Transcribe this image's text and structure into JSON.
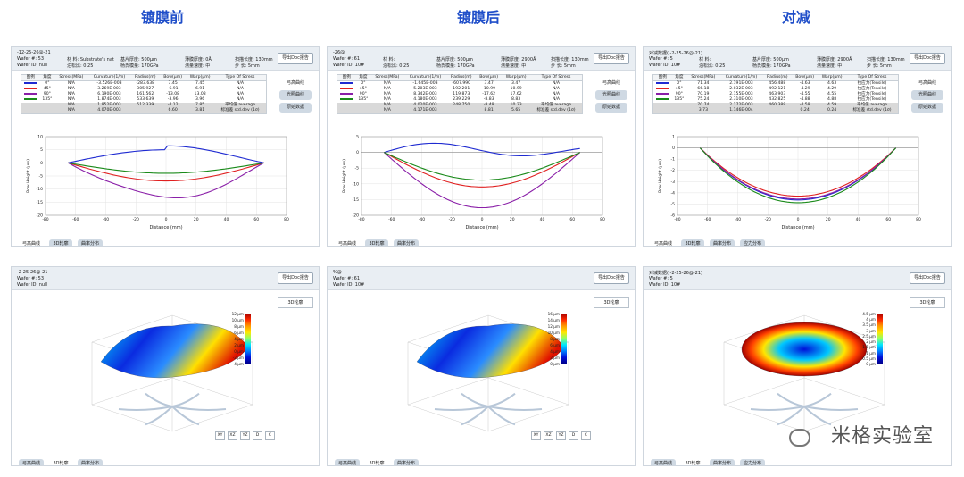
{
  "titles": [
    "镀膜前",
    "镀膜后",
    "对减"
  ],
  "panels_top": [
    {
      "title": "-12-25-26@-21",
      "wafer": "Wafer #: 53",
      "wafer_id": "Wafer ID: null",
      "mat": "材 料: Substrate's nat",
      "poisson": "泊松比: 0.25",
      "thk": "基片厚度: 500μm",
      "mod": "杨氏模量: 170GPa",
      "film": "薄膜厚度: 0Å",
      "spd": "测量速度: 中",
      "len": "扫描长度: 130mm",
      "step": "步 长: 5mm",
      "rows": [
        {
          "c": "#1f2bd1",
          "a": "0°",
          "s": "N/A",
          "cu": "-3.526E-003",
          "r": "-283.638",
          "b": "7.45",
          "w": "7.45",
          "t": "N/A"
        },
        {
          "c": "#e02020",
          "a": "45°",
          "s": "N/A",
          "cu": "3.269E-003",
          "r": "305.927",
          "b": "-6.91",
          "w": "6.91",
          "t": "N/A"
        },
        {
          "c": "#8a1fa8",
          "a": "90°",
          "s": "N/A",
          "cu": "6.190E-003",
          "r": "161.562",
          "b": "-13.08",
          "w": "13.08",
          "t": "N/A"
        },
        {
          "c": "#1a8a1a",
          "a": "135°",
          "s": "N/A",
          "cu": "1.874E-003",
          "r": "533.639",
          "b": "-3.96",
          "w": "3.96",
          "t": "N/A"
        },
        {
          "c": "",
          "a": "",
          "s": "N/A",
          "cu": "1.952E-003",
          "r": "512.339",
          "b": "-4.12",
          "w": "7.85",
          "t": "平均值 average",
          "g": 1
        },
        {
          "c": "",
          "a": "",
          "s": "N/A",
          "cu": "4.070E-003",
          "r": "",
          "b": "6.60",
          "w": "3.81",
          "t": "标准差 std.dev (1σ)",
          "g": 1
        }
      ],
      "yl": [
        10,
        5,
        0,
        -5,
        -10,
        -15,
        -20
      ],
      "ymin": -20,
      "ymax": 10,
      "tabs": [
        "弓高曲线",
        "3D轮廓",
        "曲率分布"
      ]
    },
    {
      "title": "-26@",
      "wafer": "Wafer #: 61",
      "wafer_id": "Wafer ID: 10#",
      "mat": "材 料:",
      "poisson": "泊松比: 0.25",
      "thk": "基片厚度: 500μm",
      "mod": "杨氏模量: 170GPa",
      "film": "薄膜厚度: 2900Å",
      "spd": "测量速度: 中",
      "len": "扫描长度: 130mm",
      "step": "步 长: 5mm",
      "rows": [
        {
          "c": "#1f2bd1",
          "a": "0°",
          "s": "N/A",
          "cu": "-1.645E-003",
          "r": "-607.990",
          "b": "3.47",
          "w": "3.47",
          "t": "N/A"
        },
        {
          "c": "#e02020",
          "a": "45°",
          "s": "N/A",
          "cu": "5.203E-003",
          "r": "192.201",
          "b": "-10.99",
          "w": "10.99",
          "t": "N/A"
        },
        {
          "c": "#8a1fa8",
          "a": "90°",
          "s": "N/A",
          "cu": "8.342E-003",
          "r": "119.873",
          "b": "-17.62",
          "w": "17.62",
          "t": "N/A"
        },
        {
          "c": "#1a8a1a",
          "a": "135°",
          "s": "N/A",
          "cu": "4.180E-003",
          "r": "239.229",
          "b": "-8.83",
          "w": "8.83",
          "t": "N/A"
        },
        {
          "c": "",
          "a": "",
          "s": "N/A",
          "cu": "4.020E-003",
          "r": "248.750",
          "b": "-8.49",
          "w": "10.23",
          "t": "平均值 average",
          "g": 1
        },
        {
          "c": "",
          "a": "",
          "s": "N/A",
          "cu": "4.171E-003",
          "r": "",
          "b": "8.81",
          "w": "5.65",
          "t": "标准差 std.dev (1σ)",
          "g": 1
        }
      ],
      "yl": [
        5,
        0,
        -5,
        -10,
        -15,
        -20
      ],
      "ymin": -20,
      "ymax": 5,
      "tabs": [
        "弓高曲线",
        "3D轮廓",
        "曲率分布"
      ]
    },
    {
      "title": "对减数据( -2-25-26@-21)",
      "wafer": "Wafer #: 5",
      "wafer_id": "Wafer ID: 10#",
      "mat": "材 料:",
      "poisson": "泊松比: 0.25",
      "thk": "基片厚度: 500μm",
      "mod": "杨氏模量: 170GPa",
      "film": "薄膜厚度: 2900Å",
      "spd": "测量速度: 中",
      "len": "扫描长度: 130mm",
      "step": "步 长: 5mm",
      "rows": [
        {
          "c": "#1f2bd1",
          "a": "0°",
          "s": "71.34",
          "cu": "2.191E-003",
          "r": "456.488",
          "b": "-4.63",
          "w": "4.63",
          "t": "拉应力(Tensile)"
        },
        {
          "c": "#e02020",
          "a": "45°",
          "s": "66.18",
          "cu": "2.032E-003",
          "r": "492.121",
          "b": "-4.29",
          "w": "4.29",
          "t": "拉应力(Tensile)"
        },
        {
          "c": "#8a1fa8",
          "a": "90°",
          "s": "70.19",
          "cu": "2.155E-003",
          "r": "463.903",
          "b": "-4.55",
          "w": "4.55",
          "t": "拉应力(Tensile)"
        },
        {
          "c": "#1a8a1a",
          "a": "135°",
          "s": "75.24",
          "cu": "2.310E-003",
          "r": "432.825",
          "b": "-4.88",
          "w": "4.88",
          "t": "拉应力(Tensile)"
        },
        {
          "c": "",
          "a": "",
          "s": "70.74",
          "cu": "2.172E-003",
          "r": "460.389",
          "b": "-4.59",
          "w": "4.59",
          "t": "平均值 average",
          "g": 1
        },
        {
          "c": "",
          "a": "",
          "s": "3.73",
          "cu": "1.146E-004",
          "r": "",
          "b": "0.24",
          "w": "0.24",
          "t": "标准差 std.dev (1σ)",
          "g": 1
        }
      ],
      "yl": [
        1,
        0,
        -1,
        -2,
        -3,
        -4,
        -5,
        -6
      ],
      "ymin": -6,
      "ymax": 1,
      "tabs": [
        "弓高曲线",
        "3D轮廓",
        "曲率分布",
        "应力分布"
      ]
    }
  ],
  "headers": [
    "图例",
    "角度",
    "Stress(MPa)",
    "Curvature(1/m)",
    "Radius(m)",
    "Bow(μm)",
    "Warp(μm)",
    "Type Of Stress"
  ],
  "side": {
    "label": "弓高曲线",
    "btn1": "光照曲线",
    "btn2": "原始数据"
  },
  "export": "导出Doc报告",
  "xticks": [
    -80,
    -60,
    -40,
    -20,
    0,
    20,
    40,
    60,
    80
  ],
  "xlabel": "Distance (mm)",
  "ylabel": "Bow Height (μm)",
  "panels_bottom": [
    {
      "title": "-2-25-26@-21",
      "wafer": "Wafer #: 53",
      "wafer_id": "Wafer ID: null",
      "cb": [
        "12 μm",
        "10 μm",
        "8 μm",
        "6 μm",
        "4 μm",
        "2 μm",
        "0 μm",
        "-2 μm",
        "-4 μm"
      ],
      "tabs": [
        "弓高曲线",
        "3D轮廓",
        "曲率分布"
      ]
    },
    {
      "title": "%@",
      "wafer": "Wafer #: 61",
      "wafer_id": "Wafer ID: 10#",
      "cb": [
        "16 μm",
        "14 μm",
        "12 μm",
        "10 μm",
        "8 μm",
        "6 μm",
        "4 μm",
        "2 μm",
        "0 μm"
      ],
      "tabs": [
        "弓高曲线",
        "3D轮廓",
        "曲率分布"
      ]
    },
    {
      "title": "对减数据( -2-25-26@-21)",
      "wafer": "Wafer #: 5",
      "wafer_id": "Wafer ID: 10#",
      "cb": [
        "4.5 μm",
        "4 μm",
        "3.5 μm",
        "3 μm",
        "2.5 μm",
        "2 μm",
        "1.5 μm",
        "1 μm",
        "0.5 μm",
        "0 μm"
      ],
      "tabs": [
        "弓高曲线",
        "3D轮廓",
        "曲率分布",
        "应力分布"
      ]
    }
  ],
  "view_btns": [
    "XY",
    "XZ",
    "YZ",
    "D",
    "C"
  ],
  "btn3d": "3D轮廓",
  "watermark": "米格实验室"
}
